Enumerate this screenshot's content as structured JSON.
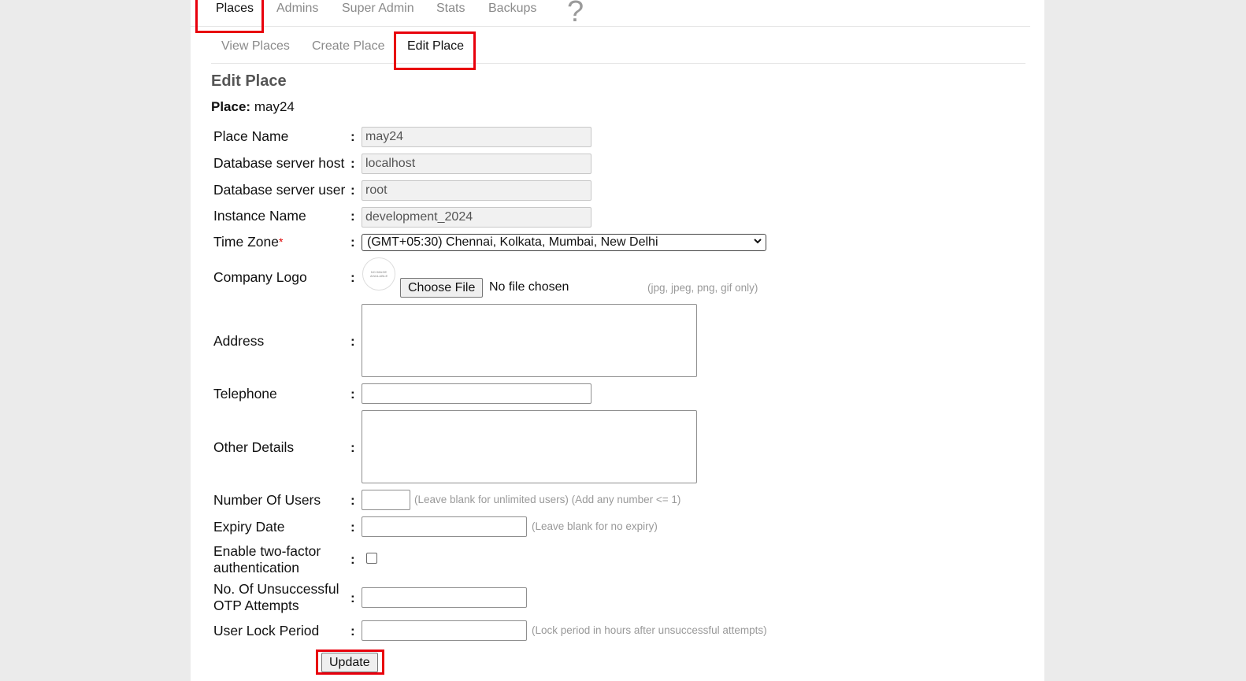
{
  "nav": {
    "tabs": [
      "Places",
      "Admins",
      "Super Admin",
      "Stats",
      "Backups"
    ],
    "active_tab": "Places",
    "help_symbol": "?"
  },
  "subnav": {
    "tabs": [
      "View Places",
      "Create Place",
      "Edit Place"
    ],
    "active_tab": "Edit Place"
  },
  "page": {
    "title": "Edit Place",
    "place_label": "Place:",
    "place_value": "may24"
  },
  "form": {
    "place_name": {
      "label": "Place Name",
      "value": "may24"
    },
    "db_host": {
      "label": "Database server host",
      "value": "localhost"
    },
    "db_user": {
      "label": "Database server user",
      "value": "root"
    },
    "instance_name": {
      "label": "Instance Name",
      "value": "development_2024"
    },
    "time_zone": {
      "label": "Time Zone",
      "required_mark": "*",
      "value": "(GMT+05:30) Chennai, Kolkata, Mumbai, New Delhi"
    },
    "company_logo": {
      "label": "Company Logo",
      "placeholder_image_text": "NO IMAGE AVAILABLE",
      "choose_button": "Choose File",
      "status": "No file chosen",
      "hint": "(jpg, jpeg, png, gif only)"
    },
    "address": {
      "label": "Address",
      "value": ""
    },
    "telephone": {
      "label": "Telephone",
      "value": ""
    },
    "other_details": {
      "label": "Other Details",
      "value": ""
    },
    "number_of_users": {
      "label": "Number Of Users",
      "value": "",
      "hint": "(Leave blank for unlimited users) (Add any number <= 1)"
    },
    "expiry_date": {
      "label": "Expiry Date",
      "value": "",
      "hint": "(Leave blank for no expiry)"
    },
    "two_factor": {
      "label_line1": "Enable two-factor",
      "label_line2": "authentication",
      "checked": false
    },
    "otp_attempts": {
      "label_line1": "No. Of Unsuccessful",
      "label_line2": "OTP Attempts",
      "value": ""
    },
    "user_lock_period": {
      "label": "User Lock Period",
      "value": "",
      "hint": "(Lock period in hours after unsuccessful attempts)"
    },
    "colon": ":",
    "submit_label": "Update"
  },
  "colors": {
    "highlight": "#e8000c",
    "page_background": "#ebebeb",
    "inactive_tab": "#8a8a8a"
  },
  "icons": {
    "help": "question-mark-icon",
    "resize": "resize-grip-icon",
    "dropdown": "chevron-down-icon"
  }
}
